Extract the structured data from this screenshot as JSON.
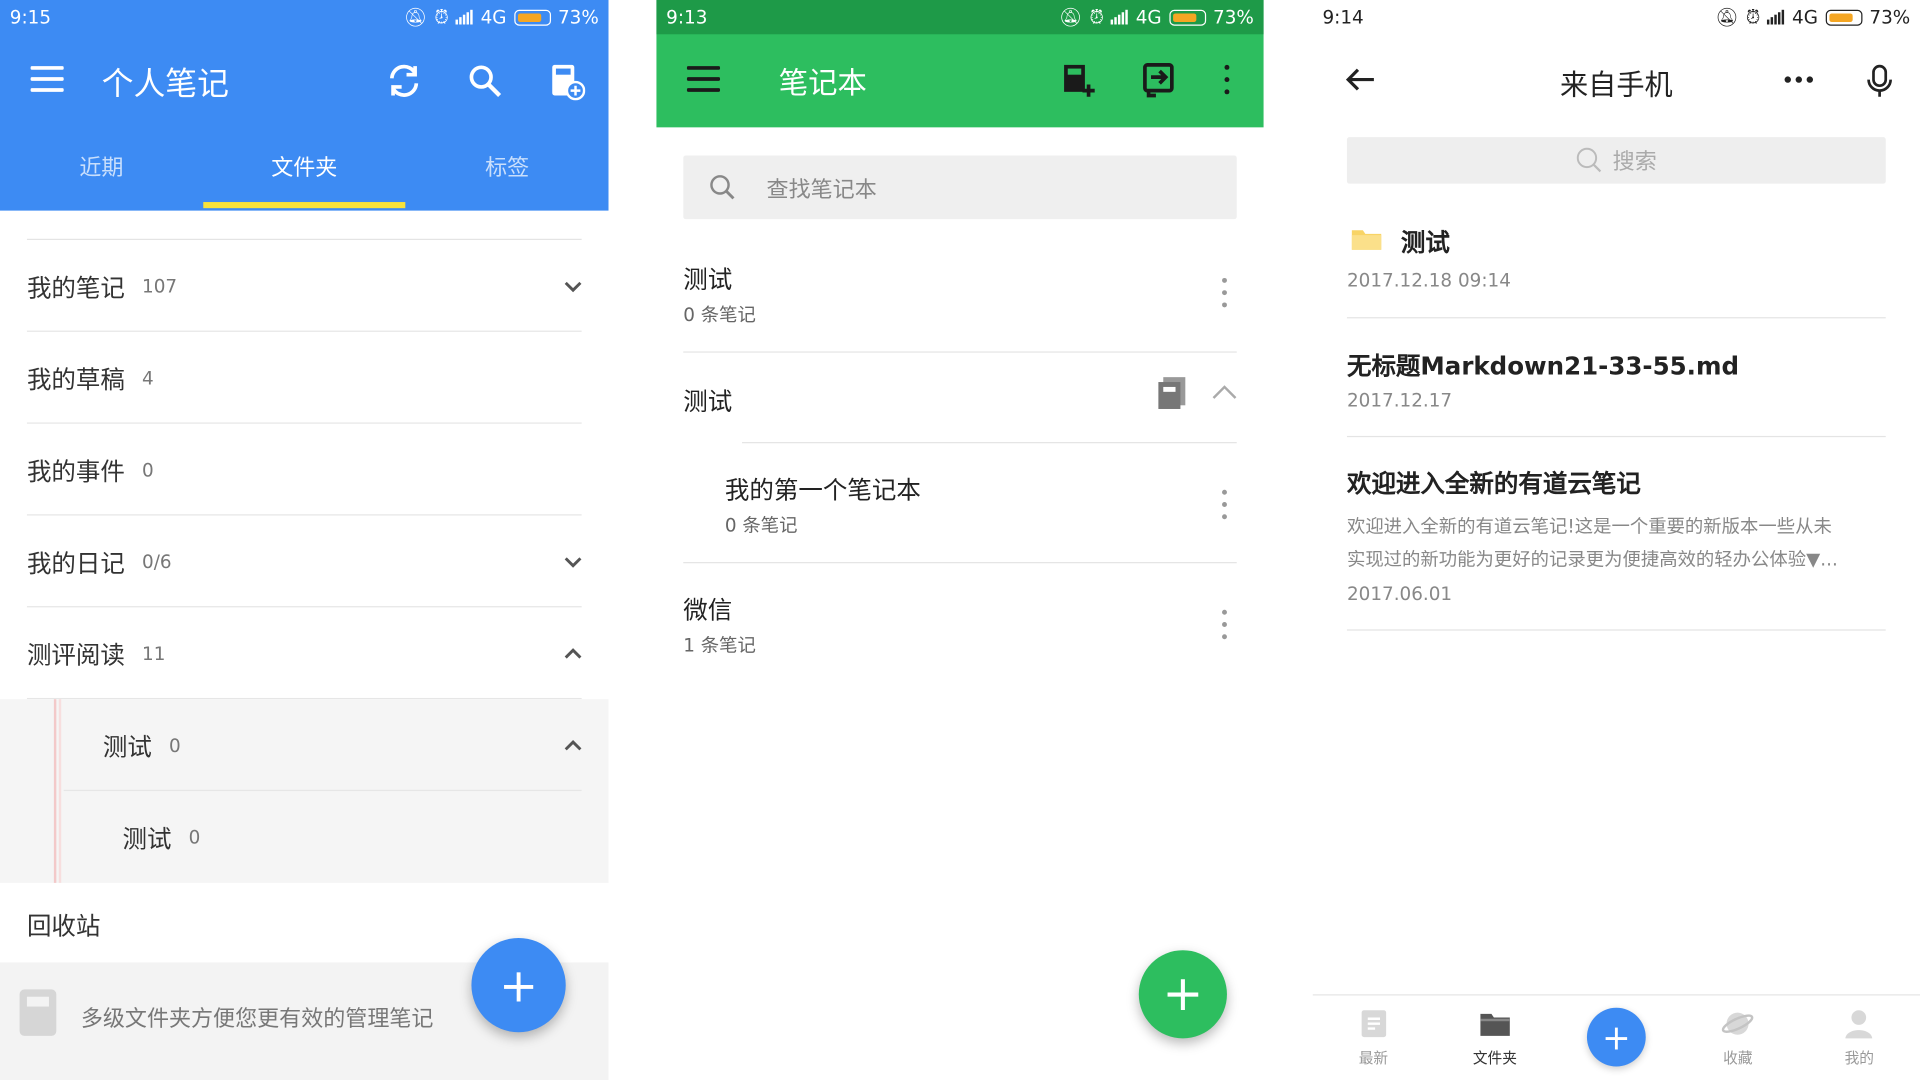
{
  "colors": {
    "s1_blue": "#3d8bf3",
    "s1_tab_indicator": "#f7e23b",
    "s2_green": "#2dbe5f",
    "s2_status": "#1e9a48",
    "s3_fab_blue": "#3d8bf3"
  },
  "screen1": {
    "status": {
      "time": "9:15",
      "network": "4G",
      "battery": "73%"
    },
    "title": "个人笔记",
    "icons": [
      "menu-icon",
      "sync-icon",
      "search-icon",
      "new-notebook-icon"
    ],
    "tabs": [
      "近期",
      "文件夹",
      "标签"
    ],
    "active_tab": "文件夹",
    "folders": [
      {
        "name": "我的笔记",
        "count": "107"
      },
      {
        "name": "我的草稿",
        "count": "4"
      },
      {
        "name": "我的事件",
        "count": "0"
      },
      {
        "name": "我的日记",
        "count": "0/6"
      },
      {
        "name": "测评阅读",
        "count": "11"
      },
      {
        "name": "测试",
        "count": "0"
      },
      {
        "name": "测试",
        "count": "0"
      }
    ],
    "recycle": "回收站",
    "tip": "多级文件夹方便您更有效的管理笔记",
    "fab": "+"
  },
  "screen2": {
    "status": {
      "time": "9:13",
      "network": "4G",
      "battery": "73%"
    },
    "title": "笔记本",
    "search_placeholder": "查找笔记本",
    "notebooks": [
      {
        "name": "测试",
        "sub": "0 条笔记"
      },
      {
        "name": "测试"
      },
      {
        "name": "我的第一个笔记本",
        "sub": "0 条笔记"
      },
      {
        "name": "微信",
        "sub": "1 条笔记"
      }
    ],
    "fab": "+"
  },
  "screen3": {
    "status": {
      "time": "9:14",
      "network": "4G",
      "battery": "73%"
    },
    "title": "来自手机",
    "search_placeholder": "搜索",
    "items": [
      {
        "title": "测试",
        "date": "2017.12.18 09:14"
      },
      {
        "title": "无标题Markdown21-33-55.md",
        "date": "2017.12.17"
      },
      {
        "title": "欢迎进入全新的有道云笔记",
        "preview1": "欢迎进入全新的有道云笔记!这是一个重要的新版本一些从未",
        "preview2": "实现过的新功能为更好的记录更为便捷高效的轻办公体验▼...",
        "date": "2017.06.01"
      }
    ],
    "nav": [
      {
        "label": "最新"
      },
      {
        "label": "文件夹"
      },
      {
        "label": "+"
      },
      {
        "label": "收藏"
      },
      {
        "label": "我的"
      }
    ]
  }
}
